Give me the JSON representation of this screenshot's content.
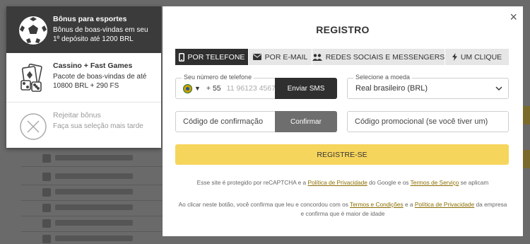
{
  "bonuses": [
    {
      "title": "Bônus para esportes",
      "line1": "Bônus de boas-vindas em seu",
      "line2": "1º depósito até 1200 BRL",
      "icon": "soccer-ball-icon"
    },
    {
      "title": "Cassino + Fast Games",
      "line1": "Pacote de boas-vindas de até",
      "line2": "10800 BRL + 290 FS",
      "icon": "casino-cards-dice-icon"
    },
    {
      "title": "Rejeitar bônus",
      "line1": "Faça sua seleção mais tarde",
      "line2": "",
      "icon": "reject-x-icon"
    }
  ],
  "modal": {
    "title": "REGISTRO",
    "close_label": "×",
    "tabs": [
      {
        "label": "POR TELEFONE",
        "icon": "phone-icon",
        "active": true
      },
      {
        "label": "POR E-MAIL",
        "icon": "envelope-icon",
        "active": false
      },
      {
        "label": "REDES SOCIAIS E MESSENGERS",
        "icon": "people-icon",
        "active": false
      },
      {
        "label": "UM CLIQUE",
        "icon": "lightning-icon",
        "active": false
      }
    ],
    "phone": {
      "legend": "Seu número de telefone",
      "code": "+ 55",
      "placeholder": "11 96123 4567",
      "sms_button": "Enviar SMS"
    },
    "currency": {
      "legend": "Selecione a moeda",
      "value": "Real brasileiro (BRL)"
    },
    "code": {
      "placeholder": "Código de confirmação",
      "confirm_button": "Confirmar"
    },
    "promo": {
      "placeholder": "Código promocional (se você tiver um)"
    },
    "register_button": "REGISTRE-SE",
    "recaptcha": {
      "before": "Esse site é protegido por reCAPTCHA e a ",
      "privacy_link": "Política de Privacidade",
      "middle": " do Google e os ",
      "terms_link": "Termos de Serviço",
      "after": " se aplicam"
    },
    "consent": {
      "before": "Ao clicar neste botão, você confirma que leu e concordou com os ",
      "terms_link": "Termos e Condições",
      "middle": " e a ",
      "privacy_link": "Política de Privacidade",
      "after": " da empresa e confirma que é maior de idade"
    }
  },
  "colors": {
    "accent": "#f6d55c",
    "dark": "#2f2f2f",
    "link": "#8a6d00"
  }
}
